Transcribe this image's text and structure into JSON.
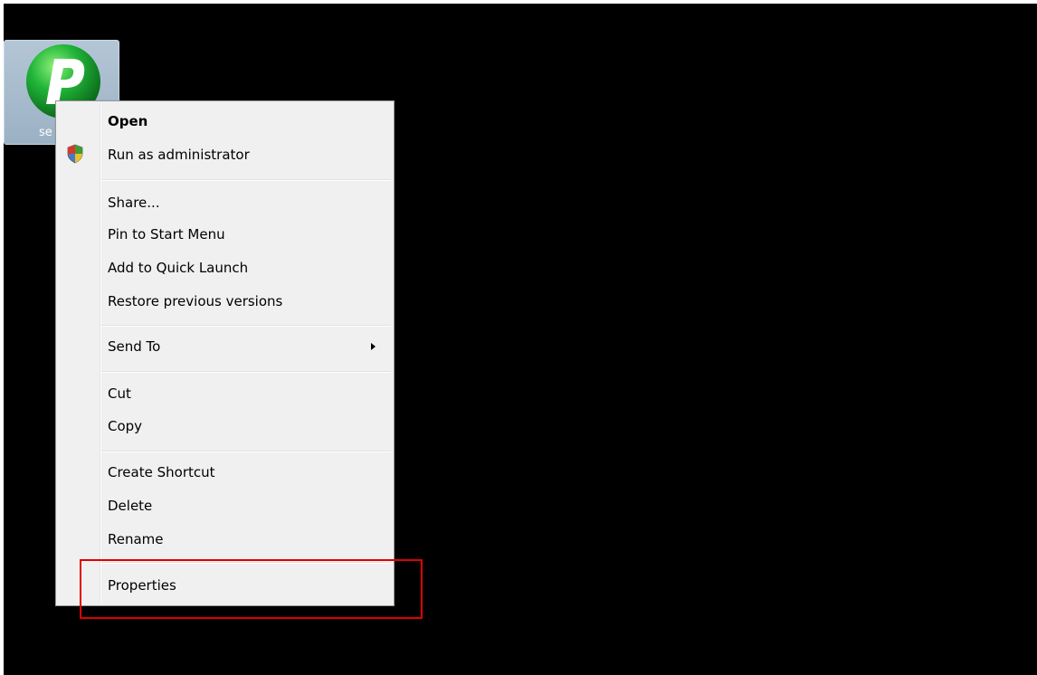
{
  "desktop": {
    "icon": {
      "label": "se",
      "icon_name": "green-p-app-icon"
    }
  },
  "context_menu": {
    "items": [
      {
        "label": "Open",
        "bold": true
      },
      {
        "label": "Run as administrator",
        "icon": "uac-shield-icon"
      },
      {
        "label": "Share..."
      },
      {
        "label": "Pin to Start Menu"
      },
      {
        "label": "Add to Quick Launch"
      },
      {
        "label": "Restore previous versions"
      },
      {
        "label": "Send To",
        "submenu": true
      },
      {
        "label": "Cut"
      },
      {
        "label": "Copy"
      },
      {
        "label": "Create Shortcut"
      },
      {
        "label": "Delete"
      },
      {
        "label": "Rename"
      },
      {
        "label": "Properties"
      }
    ]
  },
  "annotation": {
    "color": "#e00000",
    "target": "Properties"
  },
  "colors": {
    "menu_bg": "#f0f0f0",
    "desktop_bg": "#000000",
    "icon_green": "#1fa83a"
  }
}
